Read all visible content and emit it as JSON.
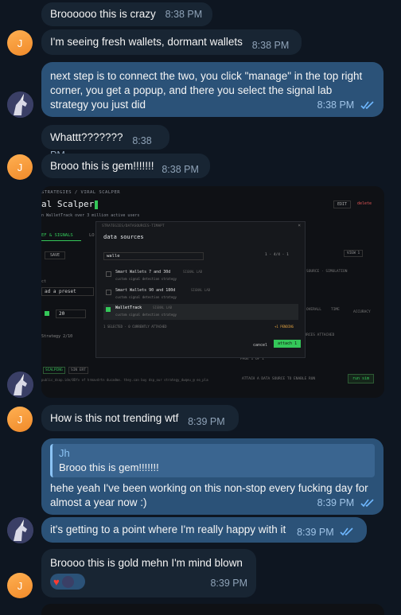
{
  "messages": {
    "m1": {
      "text": "Broooooo this is crazy",
      "time": "8:38 PM"
    },
    "m2": {
      "text": "I'm seeing fresh wallets, dormant wallets",
      "time": "8:38 PM"
    },
    "m3": {
      "line1": "next step is to connect the two, you click \"manage\" in the top right",
      "line2": "corner, you get a popup, and there you select the signal lab",
      "line3": "strategy you just did",
      "time": "8:38 PM"
    },
    "m4": {
      "text": "Whattt???????",
      "time": "8:38 PM"
    },
    "m5": {
      "text": "Brooo this is gem!!!!!!!",
      "time": "8:38 PM"
    },
    "m6": {
      "text": "How is this not trending wtf",
      "time": "8:39 PM"
    },
    "m7": {
      "quote_author": "Jh",
      "quote_text": "Brooo this is gem!!!!!!!",
      "line1": "hehe yeah I've been working on this non-stop every fucking day for",
      "line2": "almost a year now :)",
      "time": "8:39 PM"
    },
    "m8": {
      "text": "it's getting to a point where I'm really happy with it",
      "time": "8:39 PM"
    },
    "m9": {
      "text": "Broooo this is gold mehn I'm mind blown",
      "time": "8:39 PM"
    }
  },
  "avatar_letter": "J",
  "colors": {
    "bg": "#0e1621",
    "incoming": "#182533",
    "outgoing": "#2b5278",
    "avatar_j": "#f5a142",
    "accent_green": "#34c759",
    "read_ticks": "#6fb8ff"
  },
  "screenshot": {
    "breadcrumb": "STRATEGIES / VIRAL SCALPER",
    "title": "al Scalper",
    "subtitle": "n WalletTrack over 3 million active users",
    "edit": "EDIT",
    "delete": "delete",
    "tab1": "EF & SIGNALS",
    "tab2": "LO",
    "save": "SAVE",
    "preset_label": "ct",
    "preset": "ad a preset",
    "field_value": "20",
    "strat_row": "Strategy 2/10",
    "mini_tag1": "SCALPING",
    "mini_tag2": "SIN ERT",
    "bottom_text": "public_dsap.ide/8Dfv of hrmavdrtn ducadme. they.can buy dsp_our strategy_dwqeu_@ eo_plan_ebort",
    "dialog": {
      "path": "STRATEGIES/DATASOURCES-TIMAPT",
      "title": "data sources",
      "search": "walle",
      "pager": "1 - 4/4 - 1",
      "items": [
        {
          "name": "Smart Wallets 7 and 30d",
          "tag": "SIGNAL LAB",
          "desc": "custom signal detection strategy",
          "checked": false
        },
        {
          "name": "Smart Wallets 90 and 180d",
          "tag": "SIGNAL LAB",
          "desc": "custom signal detection strategy",
          "checked": false
        },
        {
          "name": "WalletTrack",
          "tag": "SIGNAL LAB",
          "desc": "custom signal detection strategy",
          "checked": true
        }
      ],
      "footer_left": "1 SELECTED · 0 CURRENTLY ATTACHED",
      "footer_right": "+1 PENDING",
      "cancel": "cancel",
      "attach": "attach 1"
    },
    "right_panel": {
      "header": "SOURCE · SIMULATION",
      "tag": "VIEW 1",
      "col1": "OVERALL",
      "col2": "TIME",
      "col3": "ACCURACY",
      "attached": "SOURCES ATTACHED",
      "footer": "ATTACH A DATA SOURCE TO ENABLE RUN",
      "run": "run sim",
      "pager": "PAGE 1 OF 1"
    }
  }
}
